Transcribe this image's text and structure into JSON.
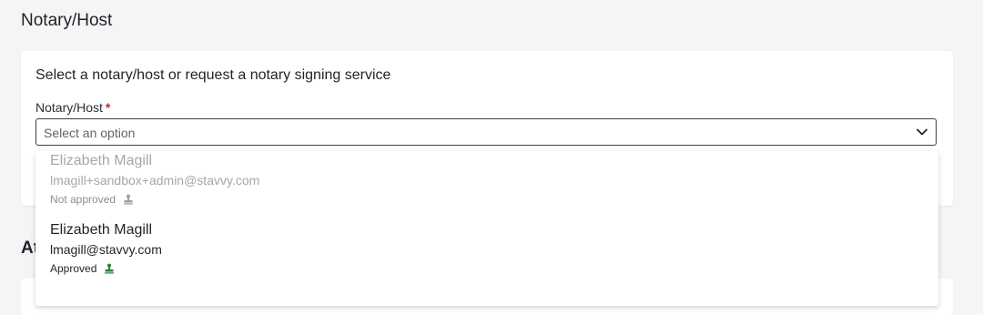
{
  "section": {
    "title": "Notary/Host"
  },
  "card": {
    "heading": "Select a notary/host or request a notary signing service",
    "field_label": "Notary/Host",
    "required_mark": "*",
    "select_placeholder": "Select an option"
  },
  "section2": {
    "title": "At"
  },
  "dropdown": {
    "options": [
      {
        "name": "Elizabeth Magill",
        "email": "lmagill+sandbox+admin@stavvy.com",
        "status": "Not approved",
        "status_icon": "stamp-icon",
        "approved": false
      },
      {
        "name": "Elizabeth Magill",
        "email": "lmagill@stavvy.com",
        "status": "Approved",
        "status_icon": "stamp-icon",
        "approved": true
      }
    ]
  },
  "colors": {
    "required": "#c62828",
    "approved_icon": "#2e7d32",
    "not_approved_icon": "#9aa0a6"
  }
}
